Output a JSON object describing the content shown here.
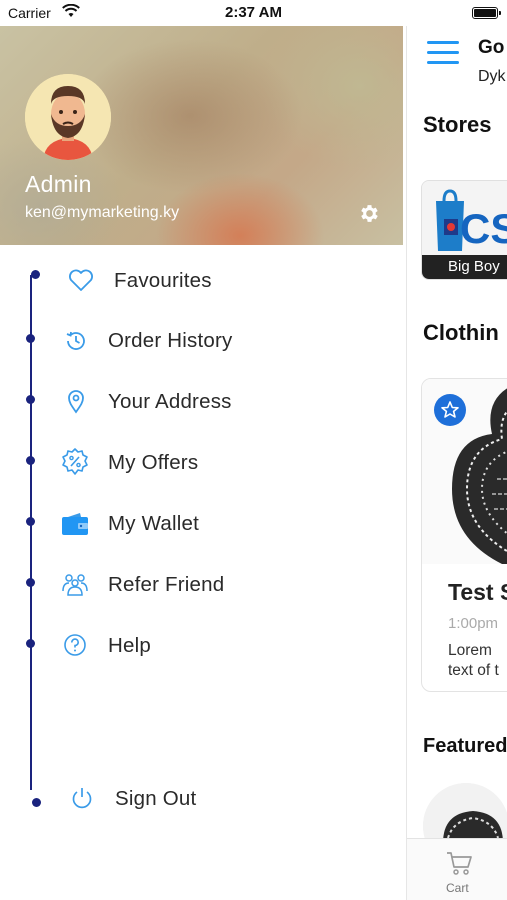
{
  "status_bar": {
    "carrier": "Carrier",
    "time": "2:37 AM"
  },
  "drawer": {
    "profile": {
      "name": "Admin",
      "email": "ken@mymarketing.ky"
    },
    "menu": [
      {
        "label": "Favourites",
        "icon": "heart-icon"
      },
      {
        "label": "Order History",
        "icon": "history-icon"
      },
      {
        "label": "Your Address",
        "icon": "location-pin-icon"
      },
      {
        "label": "My Offers",
        "icon": "discount-badge-icon"
      },
      {
        "label": "My Wallet",
        "icon": "wallet-icon"
      },
      {
        "label": "Refer Friend",
        "icon": "friends-icon"
      },
      {
        "label": "Help",
        "icon": "help-icon"
      }
    ],
    "sign_out": {
      "label": "Sign Out",
      "icon": "power-icon"
    }
  },
  "app": {
    "greeting": "Go",
    "subtitle": "Dyk",
    "sections": {
      "stores": "Stores",
      "clothing": "Clothin",
      "featured": "Featured"
    },
    "store_card": {
      "label": "Big Boy"
    },
    "clothing_card": {
      "title": "Test S",
      "time": "1:00pm",
      "desc_line1": "Lorem",
      "desc_line2": "text of t"
    },
    "tabbar": {
      "cart_label": "Cart"
    }
  },
  "colors": {
    "accent_blue": "#2196f3",
    "timeline_navy": "#1a237e",
    "icon_blue": "#3a9be8"
  }
}
